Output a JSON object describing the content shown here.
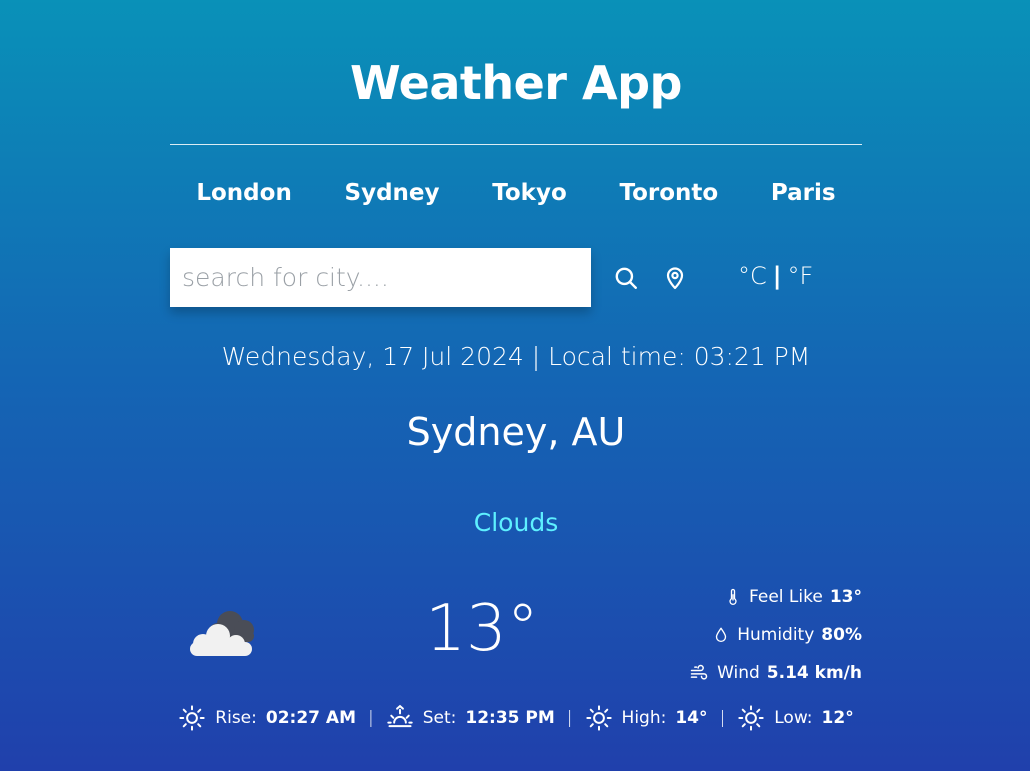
{
  "header": {
    "title": "Weather App"
  },
  "cities": [
    "London",
    "Sydney",
    "Tokyo",
    "Toronto",
    "Paris"
  ],
  "search": {
    "placeholder": "search for city....",
    "value": ""
  },
  "units": {
    "celsius": "°C",
    "separator": "|",
    "fahrenheit": "°F"
  },
  "datetime": "Wednesday, 17 Jul 2024 | Local time: 03:21 PM",
  "location": "Sydney, AU",
  "condition": "Clouds",
  "temperature": "13°",
  "weather_icon": "clouds-icon",
  "details": {
    "feels_like": {
      "label": "Feel Like",
      "value": "13°",
      "icon": "thermometer-icon"
    },
    "humidity": {
      "label": "Humidity",
      "value": "80%",
      "icon": "droplet-icon"
    },
    "wind": {
      "label": "Wind",
      "value": "5.14 km/h",
      "icon": "wind-icon"
    }
  },
  "forecast_row": {
    "rise": {
      "label": "Rise:",
      "value": "02:27 AM",
      "icon": "sunrise-icon"
    },
    "set": {
      "label": "Set:",
      "value": "12:35 PM",
      "icon": "sunset-icon"
    },
    "high": {
      "label": "High:",
      "value": "14°",
      "icon": "sun-icon"
    },
    "low": {
      "label": "Low:",
      "value": "12°",
      "icon": "sun-icon"
    },
    "separator": "|"
  },
  "colors": {
    "bg_top": "#0991b8",
    "bg_bottom": "#2040ac",
    "condition": "#5ef0ff"
  }
}
